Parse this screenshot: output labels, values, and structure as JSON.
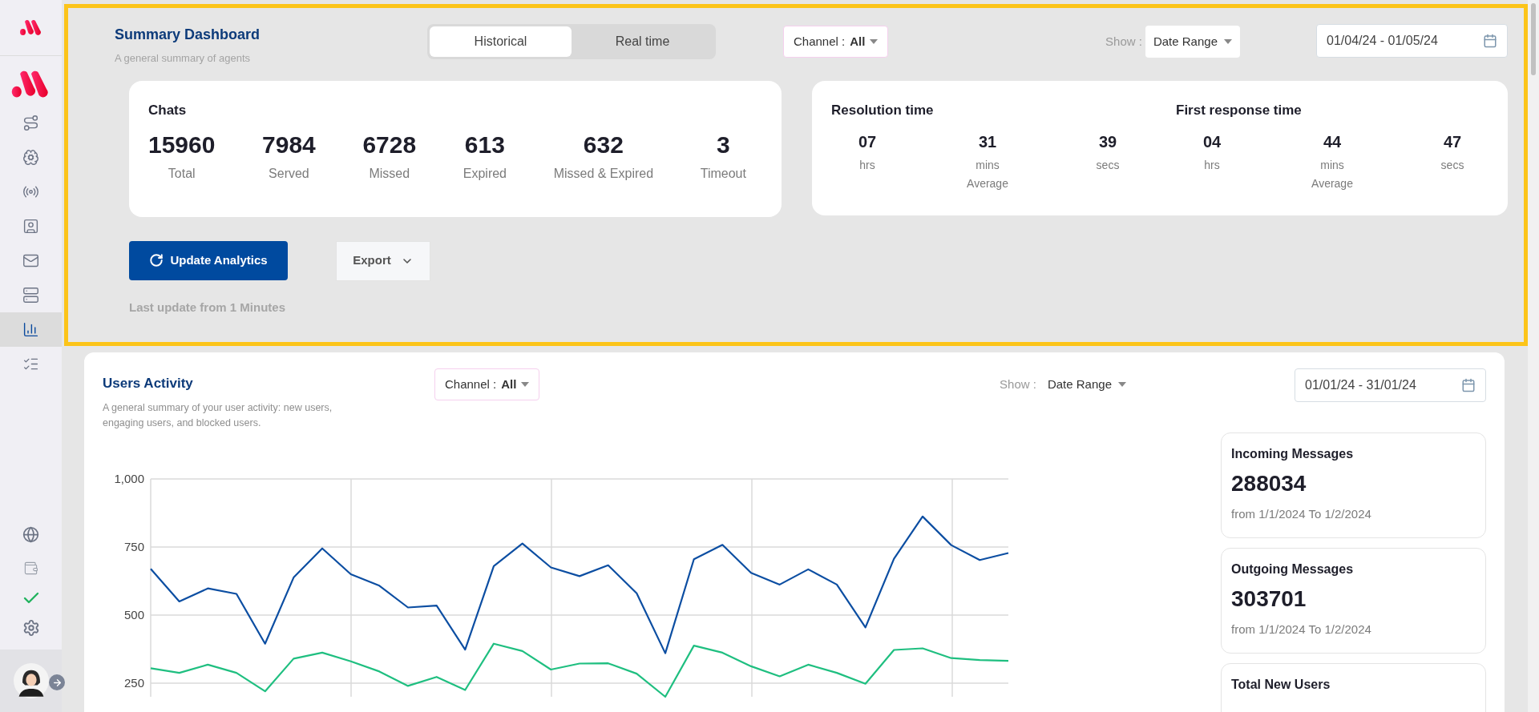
{
  "sidebar": {
    "items": [
      {
        "selected": false
      },
      {
        "selected": false
      },
      {
        "selected": false
      },
      {
        "selected": false
      },
      {
        "selected": false
      },
      {
        "selected": false
      },
      {
        "selected": true
      },
      {
        "selected": false
      }
    ]
  },
  "summary": {
    "title": "Summary Dashboard",
    "subtitle": "A general summary of agents",
    "modes": [
      {
        "label": "Historical",
        "selected": true
      },
      {
        "label": "Real time",
        "selected": false
      }
    ],
    "channel": {
      "label": "Channel :",
      "value": "All"
    },
    "show": {
      "label": "Show :",
      "value": "Date Range"
    },
    "date_range": "01/04/24 - 01/05/24",
    "chats": {
      "title": "Chats",
      "stats": [
        {
          "value": "15960",
          "label": "Total"
        },
        {
          "value": "7984",
          "label": "Served"
        },
        {
          "value": "6728",
          "label": "Missed"
        },
        {
          "value": "613",
          "label": "Expired"
        },
        {
          "value": "632",
          "label": "Missed & Expired"
        },
        {
          "value": "3",
          "label": "Timeout"
        }
      ]
    },
    "times": [
      {
        "title": "Resolution time",
        "parts": [
          {
            "value": "07",
            "unit": "hrs"
          },
          {
            "value": "31",
            "unit": "mins",
            "note": "Average"
          },
          {
            "value": "39",
            "unit": "secs"
          }
        ]
      },
      {
        "title": "First response time",
        "parts": [
          {
            "value": "04",
            "unit": "hrs"
          },
          {
            "value": "44",
            "unit": "mins",
            "note": "Average"
          },
          {
            "value": "47",
            "unit": "secs"
          }
        ]
      }
    ],
    "update_button": "Update Analytics",
    "export_button": "Export",
    "last_update": "Last update from 1 Minutes"
  },
  "users_activity": {
    "title": "Users Activity",
    "subtitle": "A general summary of your user activity: new users, engaging users, and blocked users.",
    "channel": {
      "label": "Channel :",
      "value": "All"
    },
    "show": {
      "label": "Show :",
      "value": "Date Range"
    },
    "date_range": "01/01/24 - 31/01/24",
    "chart_data": {
      "type": "line",
      "grid": true,
      "ylim": [
        200,
        1000
      ],
      "yticks": [
        {
          "value": 250,
          "label": "250"
        },
        {
          "value": 500,
          "label": "500"
        },
        {
          "value": 750,
          "label": "750"
        },
        {
          "value": 1000,
          "label": "1,000"
        }
      ],
      "series": [
        {
          "color": "#0c4ea2",
          "values": [
            670,
            550,
            598,
            578,
            395,
            638,
            745,
            650,
            608,
            528,
            535,
            373,
            680,
            763,
            675,
            643,
            683,
            580,
            360,
            705,
            758,
            655,
            612,
            668,
            612,
            455,
            707,
            862,
            757,
            702,
            728
          ]
        },
        {
          "color": "#1fbf80",
          "values": [
            305,
            288,
            318,
            288,
            220,
            340,
            362,
            330,
            293,
            240,
            273,
            225,
            395,
            368,
            300,
            322,
            323,
            285,
            200,
            388,
            362,
            312,
            275,
            318,
            288,
            248,
            372,
            378,
            342,
            335,
            332
          ]
        }
      ]
    },
    "cards": [
      {
        "title": "Incoming Messages",
        "value": "288034",
        "range": "from 1/1/2024 To 1/2/2024"
      },
      {
        "title": "Outgoing Messages",
        "value": "303701",
        "range": "from 1/1/2024 To 1/2/2024"
      },
      {
        "title": "Total New Users"
      }
    ]
  }
}
